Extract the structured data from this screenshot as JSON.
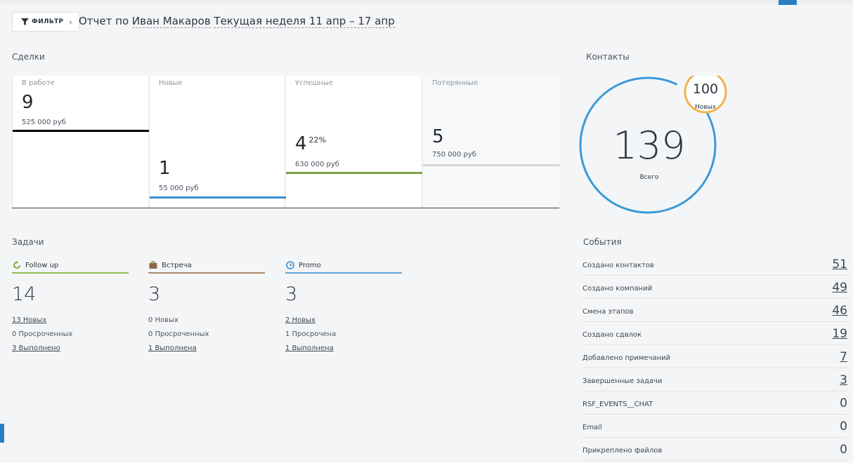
{
  "header": {
    "filter_label": "ФИЛЬТР",
    "title_prefix": "Отчет по",
    "user": "Иван Макаров",
    "period": "Текущая неделя 11 апр – 17 апр"
  },
  "sections": {
    "deals": "Сделки",
    "contacts": "Контакты",
    "tasks": "Задачи",
    "events": "События"
  },
  "deals": [
    {
      "label": "В работе",
      "count": "9",
      "sum": "525 000 руб",
      "percent": "",
      "color": "#000000"
    },
    {
      "label": "Новые",
      "count": "1",
      "sum": "55 000 руб",
      "percent": "",
      "color": "#3a8fd0"
    },
    {
      "label": "Успешные",
      "count": "4",
      "sum": "630 000 руб",
      "percent": "22%",
      "color": "#7ba245"
    },
    {
      "label": "Потерянные",
      "count": "5",
      "sum": "750 000 руб",
      "percent": "",
      "color": "#d4d6d8"
    }
  ],
  "contacts": {
    "total": "139",
    "total_label": "Всего",
    "new": "100",
    "new_label": "Новых",
    "ring_color": "#3a9ad9",
    "new_color": "#f0b44c"
  },
  "tasks": [
    {
      "name": "Follow up",
      "icon": "refresh-icon",
      "color": "#8bbf5a",
      "count": "3",
      "total": "14",
      "stats": [
        "13 Новых",
        "0 Просроченных",
        "3 Выполнено"
      ]
    },
    {
      "name": "Встреча",
      "icon": "briefcase-icon",
      "color": "#a78a6a",
      "total": "3",
      "stats": [
        "0 Новых",
        "0 Просроченных",
        "1 Выполнена"
      ]
    },
    {
      "name": "Promo",
      "icon": "clock-icon",
      "color": "#62a8dc",
      "total": "3",
      "stats": [
        "2 Новых",
        "1 Просрочена",
        "1 Выполнена"
      ]
    }
  ],
  "events": [
    {
      "name": "Создано контактов",
      "value": "51"
    },
    {
      "name": "Создано компаний",
      "value": "49"
    },
    {
      "name": "Смена этапов",
      "value": "46"
    },
    {
      "name": "Создано сдвлок",
      "value": "19"
    },
    {
      "name": "Добавлено примечаний",
      "value": "7"
    },
    {
      "name": "Завершенные задачи",
      "value": "3"
    },
    {
      "name": "RSF_EVENTS__CHAT",
      "value": "0"
    },
    {
      "name": "Email",
      "value": "0"
    },
    {
      "name": "Прикреплено файлов",
      "value": "0"
    }
  ]
}
